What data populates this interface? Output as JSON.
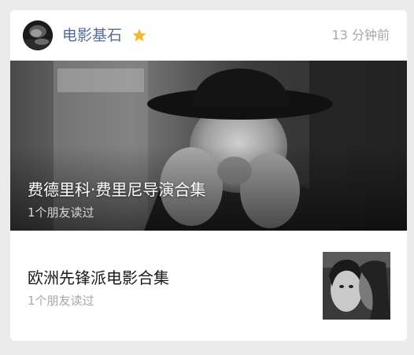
{
  "account": {
    "name": "电影基石",
    "avatar_icon": "avatar-photo",
    "badge_icon": "star-icon",
    "badge_color": "#f5b82e",
    "timestamp": "13 分钟前"
  },
  "hero_article": {
    "title": "费德里科·费里尼导演合集",
    "subtitle": "1个朋友读过"
  },
  "articles": [
    {
      "title": "欧洲先锋派电影合集",
      "subtitle": "1个朋友读过"
    }
  ],
  "colors": {
    "account_name": "#576b95",
    "muted": "#a8a8a8",
    "background": "#ebebeb"
  }
}
